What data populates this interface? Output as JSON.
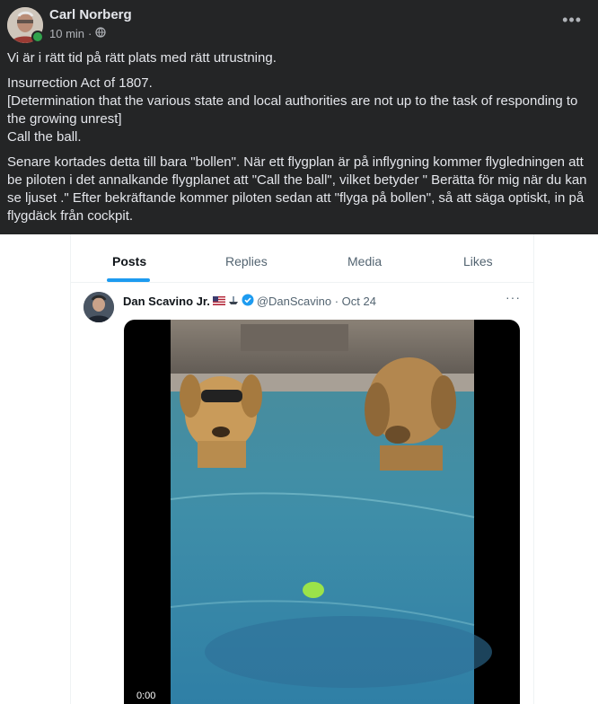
{
  "post": {
    "author": "Carl Norberg",
    "time": "10 min",
    "separator": "·",
    "more": "•••",
    "text": {
      "line1": "Vi är i rätt tid på rätt plats med rätt utrustning.",
      "line2": "Insurrection Act of 1807.",
      "line3": "[Determination that the various state and local authorities are not up to the task of responding to the growing unrest]",
      "line4": "Call the ball.",
      "line5": "Senare kortades detta till bara \"bollen\". När ett flygplan är på inflygning kommer flygledningen att be piloten i det annalkande flygplanet att \"Call the ball\", vilket betyder \" Berätta för mig när du kan se ljuset .\" Efter bekräftande kommer piloten sedan att \"flyga på bollen\", så att säga optiskt, in på flygdäck från cockpit."
    }
  },
  "embed": {
    "tabs": [
      "Posts",
      "Replies",
      "Media",
      "Likes"
    ],
    "tweet": {
      "name": "Dan Scavino Jr.",
      "handle": "@DanScavino · Oct 24",
      "more": "···",
      "video_time": "0:00"
    }
  },
  "colors": {
    "background": "#242526",
    "text": "#e4e6eb",
    "secondary": "#b0b3b8",
    "online": "#31a24c",
    "twitter_blue": "#1d9bf0"
  }
}
